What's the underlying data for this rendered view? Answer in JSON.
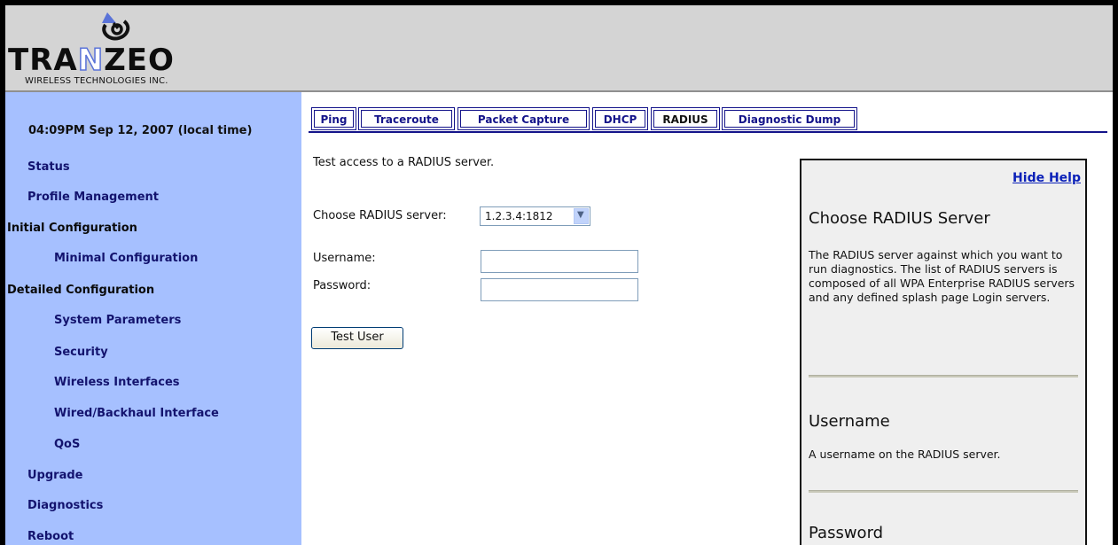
{
  "brand": {
    "name_prefix": "TRA",
    "name_mid": "N",
    "name_suffix": "ZEO",
    "tagline": "WIRELESS TECHNOLOGIES INC.",
    "icon": "satellite-dish-icon"
  },
  "sidebar": {
    "clock": "04:09PM Sep 12, 2007 (local time)",
    "items": [
      {
        "label": "Status"
      },
      {
        "label": "Profile Management"
      },
      {
        "label": "Initial Configuration"
      },
      {
        "label": "Minimal Configuration"
      },
      {
        "label": "Detailed Configuration"
      },
      {
        "label": "System Parameters"
      },
      {
        "label": "Security"
      },
      {
        "label": "Wireless Interfaces"
      },
      {
        "label": "Wired/Backhaul Interface"
      },
      {
        "label": "QoS"
      },
      {
        "label": "Upgrade"
      },
      {
        "label": "Diagnostics"
      },
      {
        "label": "Reboot"
      }
    ]
  },
  "tabs": [
    {
      "label": "Ping"
    },
    {
      "label": "Traceroute"
    },
    {
      "label": "Packet Capture"
    },
    {
      "label": "DHCP"
    },
    {
      "label": "RADIUS"
    },
    {
      "label": "Diagnostic Dump"
    }
  ],
  "active_tab": "RADIUS",
  "form": {
    "intro": "Test access to a RADIUS server.",
    "server_label": "Choose RADIUS server:",
    "server_value": "1.2.3.4:1812",
    "username_label": "Username:",
    "username_value": "",
    "password_label": "Password:",
    "password_value": "",
    "test_button": "Test User"
  },
  "help": {
    "hide_label": "Hide Help",
    "sections": [
      {
        "title": "Choose RADIUS Server",
        "text": "The RADIUS server against which you want to run diagnostics. The list of RADIUS servers is composed of all WPA Enterprise RADIUS servers and any defined splash page Login servers."
      },
      {
        "title": "Username",
        "text": "A username on the RADIUS server."
      },
      {
        "title": "Password",
        "text": ""
      }
    ]
  },
  "colors": {
    "sidebar_bg": "#a6c0ff",
    "header_bg": "#d4d4d4",
    "nav_link": "#13136e",
    "tab_border": "#14148a",
    "help_bg": "#efefef",
    "link_blue": "#0a20b8"
  }
}
